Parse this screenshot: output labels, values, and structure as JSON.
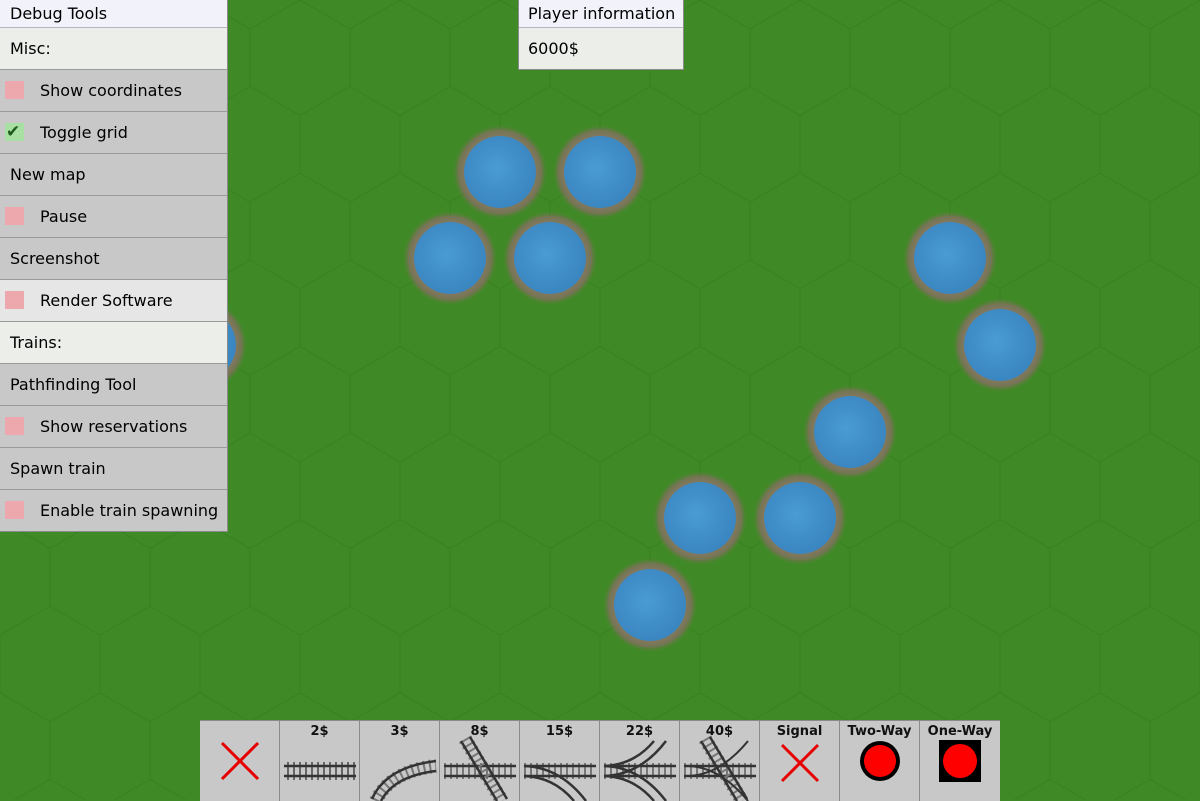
{
  "debug": {
    "title": "Debug Tools",
    "misc_label": "Misc:",
    "show_coordinates": "Show coordinates",
    "toggle_grid": "Toggle grid",
    "new_map": "New map",
    "pause": "Pause",
    "screenshot": "Screenshot",
    "render_software": "Render Software",
    "trains_label": "Trains:",
    "pathfinding_tool": "Pathfinding Tool",
    "show_reservations": "Show reservations",
    "spawn_train": "Spawn train",
    "enable_train_spawning": "Enable train spawning",
    "checkbox_on_color": "#a8e0a4",
    "checkbox_off_color": "#eda8ae"
  },
  "player": {
    "title": "Player information",
    "money": "6000$"
  },
  "toolbar": {
    "remove_icon": "red-x-icon",
    "straight_price": "2$",
    "curve_price": "3$",
    "diagonal_price": "8$",
    "switch_price": "15$",
    "double_switch_price": "22$",
    "crossing_price": "40$",
    "signal_label": "Signal",
    "two_way_label": "Two-Way",
    "one_way_label": "One-Way",
    "remove_color": "#e60000",
    "signal_color": "#ff0000"
  },
  "map": {
    "grass_color": "#3f8a26",
    "water_color": "#3d8fc9"
  }
}
